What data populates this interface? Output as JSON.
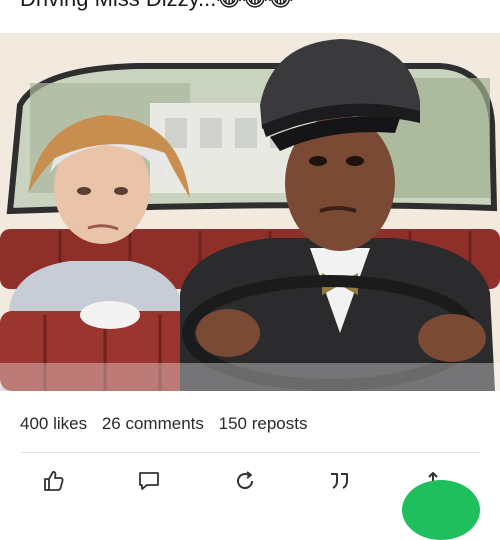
{
  "post": {
    "caption": "Driving Miss Dizzy...😂😂😂"
  },
  "stats": {
    "likes": "400 likes",
    "comments": "26 comments",
    "reposts": "150 reposts"
  },
  "actions": [
    {
      "icon": "thumbs-up-icon"
    },
    {
      "icon": "comment-icon"
    },
    {
      "icon": "repost-icon"
    },
    {
      "icon": "quote-icon"
    },
    {
      "icon": "share-icon"
    }
  ],
  "colors": {
    "accent": "#1fbf5e",
    "seat": "#8e2f2a",
    "uniform": "#2b2b2e"
  }
}
